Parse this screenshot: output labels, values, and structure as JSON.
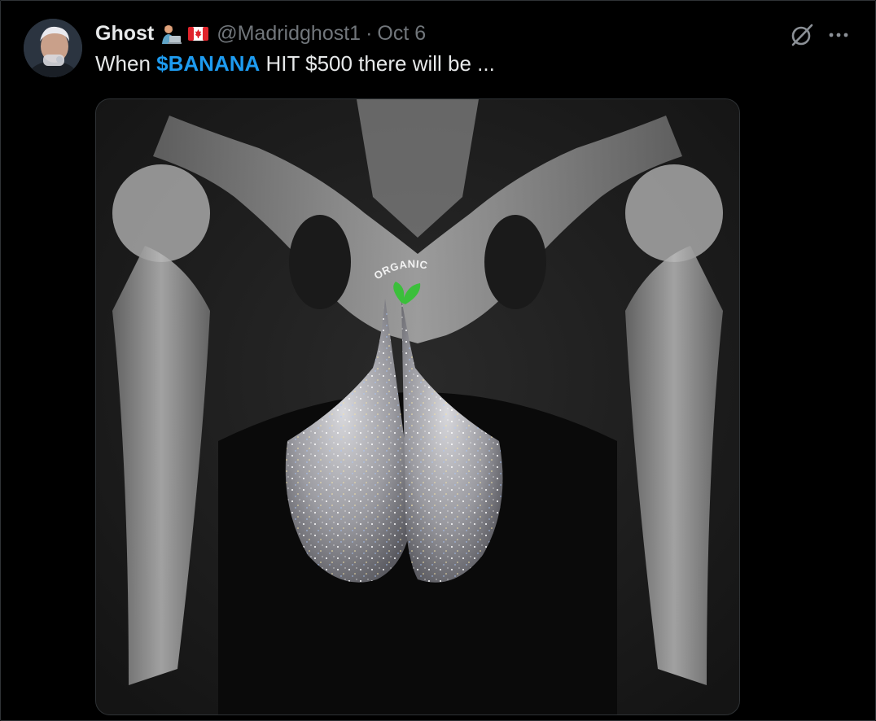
{
  "tweet": {
    "author": {
      "name": "Ghost",
      "handle": "@Madridghost1",
      "badges": [
        "technologist-emoji",
        "canada-flag-emoji"
      ]
    },
    "separator": "·",
    "date": "Oct 6",
    "text": {
      "before": "When ",
      "cashtag": "$BANANA",
      "after": " HIT $500 there will be ..."
    },
    "media": {
      "caption_on_image": "ORGANIC",
      "alt_description": "x-ray of hips with glittering sparkly shapes"
    },
    "actions": [
      "grok-icon",
      "more-options-icon"
    ]
  },
  "colors": {
    "background": "#000000",
    "text": "#e7e9ea",
    "muted": "#71767b",
    "accent": "#1d9bf0",
    "border": "#2f3336"
  }
}
